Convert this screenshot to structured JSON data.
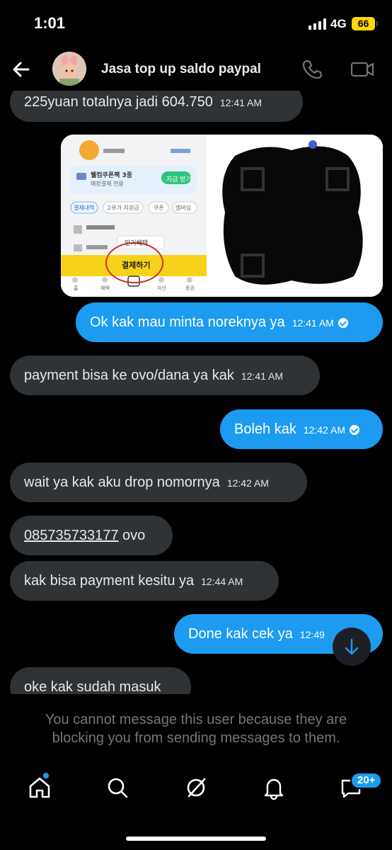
{
  "status_bar": {
    "time": "1:01",
    "network": "4G",
    "battery": "66"
  },
  "header": {
    "title": "Jasa top up saldo paypal"
  },
  "messages": [
    {
      "text": "225yuan totalnya jadi 604.750",
      "time": "12:41 AM"
    },
    {
      "text": "Ok kak mau minta noreknya ya",
      "time": "12:41 AM"
    },
    {
      "text": "payment bisa ke ovo/dana ya kak",
      "time": "12:41 AM"
    },
    {
      "text": "Boleh kak",
      "time": "12:42 AM"
    },
    {
      "text": "wait ya kak aku drop nomornya",
      "time": "12:42 AM"
    },
    {
      "link": "085735733177",
      "text": " ovo"
    },
    {
      "text": "kak bisa payment kesitu ya",
      "time": "12:44 AM"
    },
    {
      "text": "Done kak cek ya",
      "time": "12:49"
    },
    {
      "text": "oke kak sudah masuk"
    }
  ],
  "attachment": {
    "coupon_title": "웰컴쿠폰팩 3종",
    "coupon_sub": "매장결제 전용",
    "coupon_button": "지금 받기",
    "chips": [
      "결제내역",
      "고유가 지원금",
      "쿠폰",
      "멤버십"
    ],
    "dropdown": "인기혜택",
    "pay_button": "결제하기",
    "tabs": [
      "홈",
      "혜택",
      "자산",
      "증권"
    ]
  },
  "blocked_notice": "You cannot message this user because they are blocking you from sending messages to them.",
  "nav": {
    "messages_badge": "20+"
  },
  "colors": {
    "accent": "#1d9bf0",
    "incoming_bubble": "#2f3336",
    "battery": "#ffd60a"
  }
}
